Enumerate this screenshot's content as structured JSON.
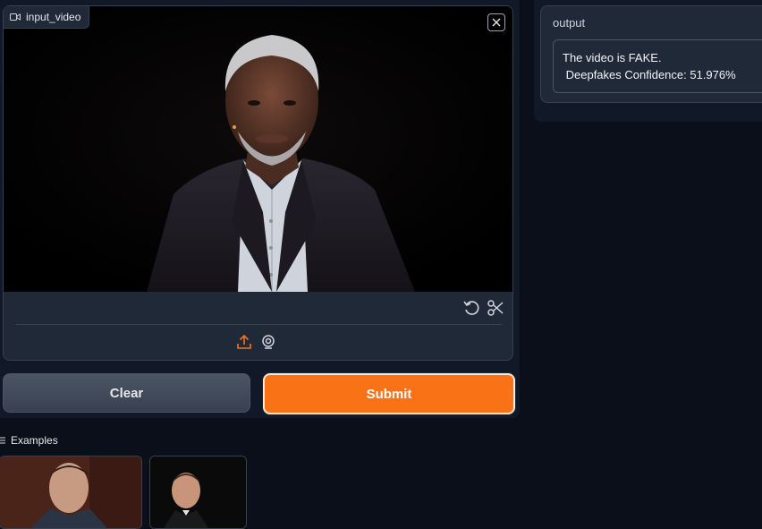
{
  "input": {
    "label": "input_video"
  },
  "actions": {
    "clear_label": "Clear",
    "submit_label": "Submit"
  },
  "output": {
    "label": "output",
    "line1": "The video is FAKE.",
    "line2": " Deepfakes Confidence: 51.976%"
  },
  "examples": {
    "label": "Examples"
  },
  "icons": {
    "video": "video-camera-icon",
    "close": "close-icon",
    "undo": "undo-icon",
    "trim": "scissors-icon",
    "upload": "upload-icon",
    "webcam": "webcam-icon",
    "list": "list-icon"
  },
  "colors": {
    "accent": "#f97316",
    "background": "#0b0f19",
    "panel": "#1f2937"
  }
}
